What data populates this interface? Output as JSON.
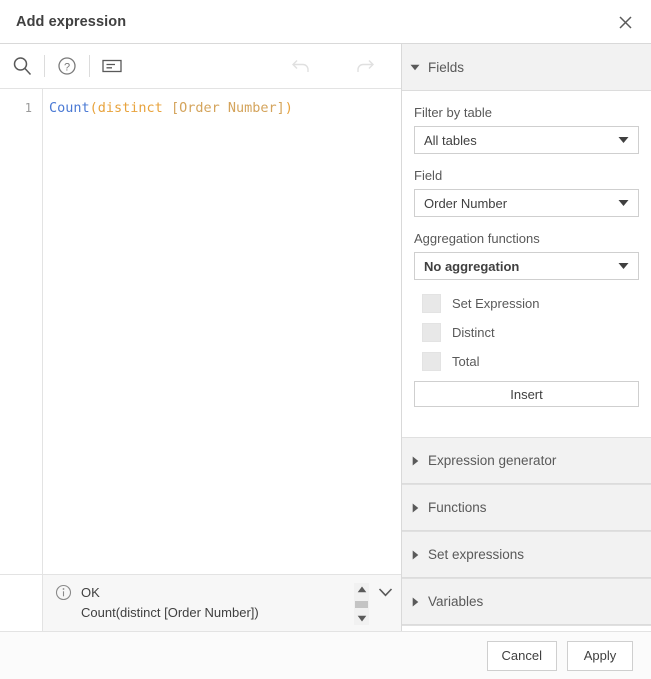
{
  "dialog": {
    "title": "Add expression",
    "close_icon": "close-icon"
  },
  "toolbar": {
    "buttons": [
      {
        "name": "search-icon",
        "tooltip": "Search"
      },
      {
        "name": "help-icon",
        "tooltip": "Help"
      },
      {
        "name": "insert-field-icon",
        "tooltip": "Insert"
      }
    ],
    "history": [
      {
        "name": "undo-icon",
        "tooltip": "Undo",
        "enabled": false
      },
      {
        "name": "redo-icon",
        "tooltip": "Redo",
        "enabled": false
      }
    ]
  },
  "editor": {
    "line_number": "1",
    "tokens": [
      {
        "text": "Count",
        "type": "function"
      },
      {
        "text": "(",
        "type": "paren"
      },
      {
        "text": "distinct",
        "type": "keyword"
      },
      {
        "text": " ",
        "type": "plain"
      },
      {
        "text": "[Order Number]",
        "type": "field"
      },
      {
        "text": ")",
        "type": "paren"
      }
    ],
    "expression": "Count(distinct [Order Number])"
  },
  "status": {
    "info_icon": "info-icon",
    "state": "OK",
    "preview": "Count(distinct [Order Number])",
    "scroll_up_icon": "caret-up-icon",
    "scroll_down_icon": "caret-down-icon",
    "expand_icon": "chevron-down-icon"
  },
  "panel": {
    "fields_section": {
      "label": "Fields",
      "expanded": true,
      "caret_icon": "caret-down-icon",
      "filter_by_table": {
        "label": "Filter by table",
        "value": "All tables",
        "caret_icon": "caret-down-icon"
      },
      "field": {
        "label": "Field",
        "value": "Order Number",
        "caret_icon": "caret-down-icon"
      },
      "aggregation": {
        "label": "Aggregation functions",
        "value": "No aggregation",
        "caret_icon": "caret-down-icon"
      },
      "checkboxes": [
        {
          "label": "Set Expression",
          "checked": false
        },
        {
          "label": "Distinct",
          "checked": false
        },
        {
          "label": "Total",
          "checked": false
        }
      ],
      "insert_label": "Insert"
    },
    "collapsed_sections": [
      {
        "label": "Expression generator",
        "caret_icon": "caret-right-icon"
      },
      {
        "label": "Functions",
        "caret_icon": "caret-right-icon"
      },
      {
        "label": "Set expressions",
        "caret_icon": "caret-right-icon"
      },
      {
        "label": "Variables",
        "caret_icon": "caret-right-icon"
      }
    ]
  },
  "footer": {
    "cancel_label": "Cancel",
    "apply_label": "Apply"
  },
  "colors": {
    "function_token": "#4a79d4",
    "keyword_token": "#e8a33d",
    "field_token": "#d4a45c",
    "section_header_bg": "#f2f2f2",
    "status_bg": "#f7f7f7"
  }
}
